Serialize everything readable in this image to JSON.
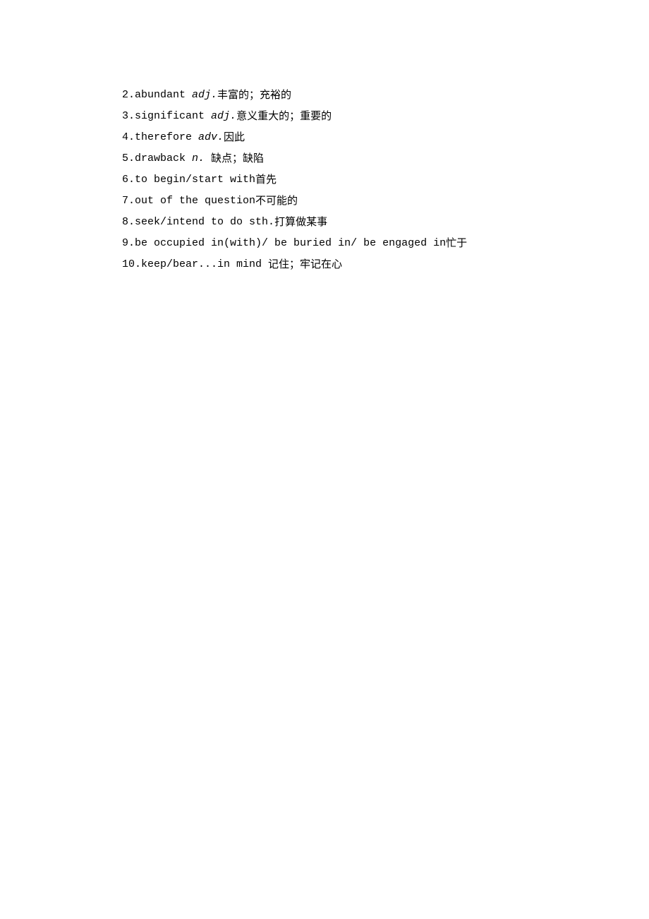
{
  "vocab": [
    {
      "num": "2. ",
      "word": "abundant ",
      "pos": "adj.",
      "def": "丰富的；充裕的"
    },
    {
      "num": "3. ",
      "word": "significant ",
      "pos": "adj.",
      "def": "意义重大的；重要的"
    },
    {
      "num": "4. ",
      "word": "therefore ",
      "pos": "adv.",
      "def": "因此"
    },
    {
      "num": "5. ",
      "word": "drawback ",
      "pos": "n. ",
      "def": "缺点；缺陷"
    },
    {
      "num": "6. ",
      "word": "to begin/start with",
      "pos": "",
      "def": "首先"
    },
    {
      "num": "7. ",
      "word": "out of the question",
      "pos": "",
      "def": "不可能的"
    },
    {
      "num": "8. ",
      "word": "seek/intend to do sth.",
      "pos": "",
      "def": "打算做某事"
    },
    {
      "num": "9. ",
      "word": "be occupied in(with)/ be buried in/ be engaged in",
      "pos": "",
      "def": "忙于"
    },
    {
      "num": "10. ",
      "word": "keep/bear...in mind ",
      "pos": "",
      "def": "记住；牢记在心"
    }
  ]
}
